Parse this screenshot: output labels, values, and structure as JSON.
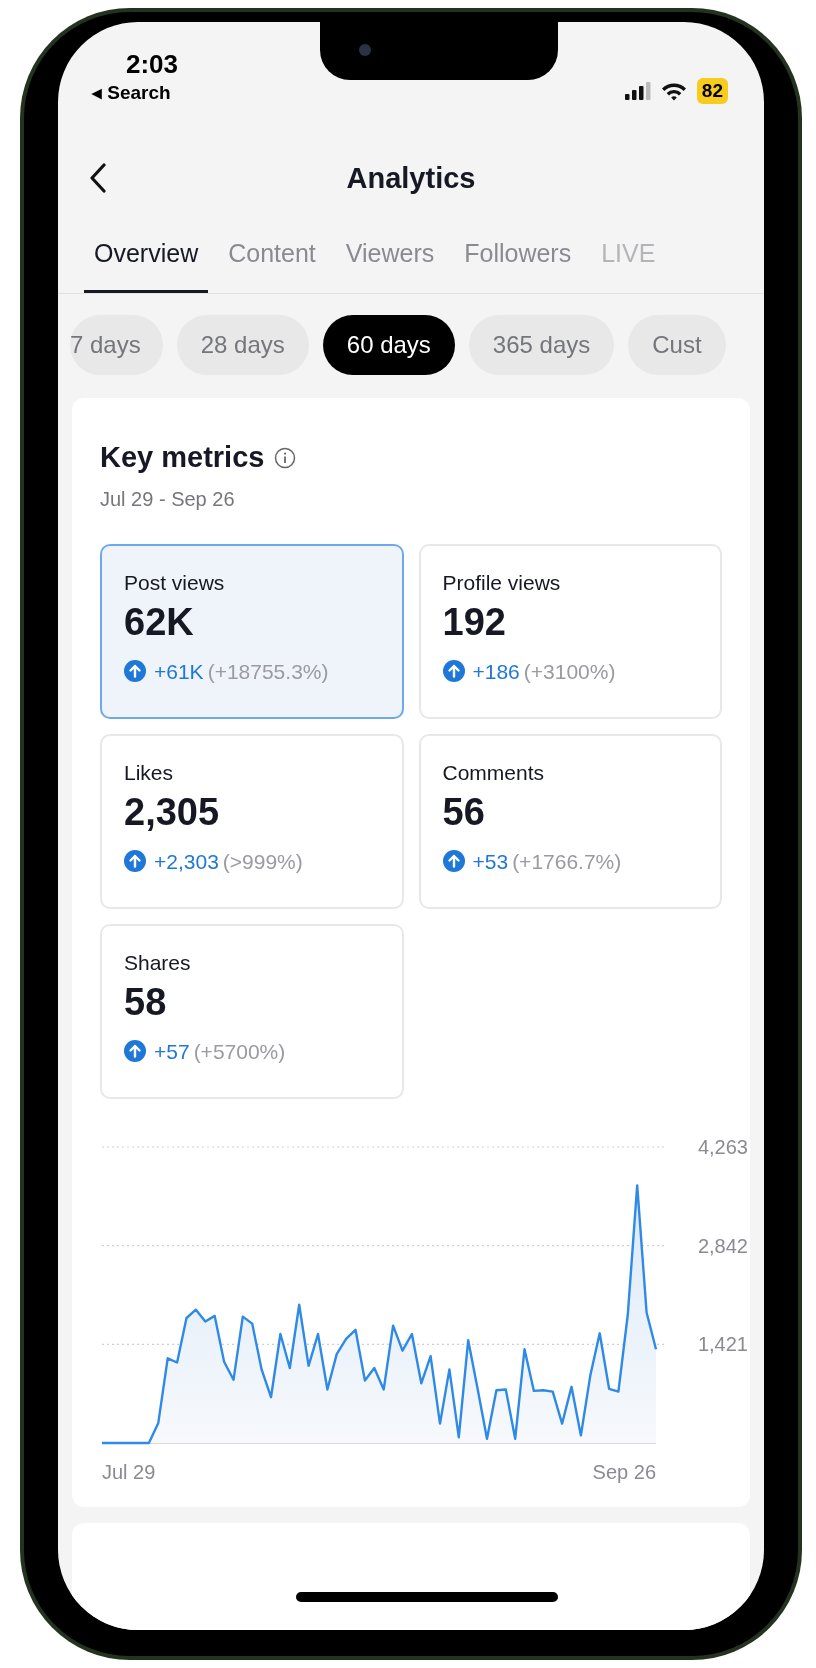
{
  "status_bar": {
    "time": "2:03",
    "back_link": "◂ Search",
    "battery": "82"
  },
  "header": {
    "title": "Analytics"
  },
  "tabs": [
    {
      "label": "Overview",
      "selected": true
    },
    {
      "label": "Content",
      "selected": false
    },
    {
      "label": "Viewers",
      "selected": false
    },
    {
      "label": "Followers",
      "selected": false
    },
    {
      "label": "LIVE",
      "selected": false
    }
  ],
  "ranges": [
    {
      "label": "7 days",
      "selected": false
    },
    {
      "label": "28 days",
      "selected": false
    },
    {
      "label": "60 days",
      "selected": true
    },
    {
      "label": "365 days",
      "selected": false
    },
    {
      "label": "Cust",
      "selected": false
    }
  ],
  "key_metrics": {
    "title": "Key metrics",
    "date_range": "Jul 29 - Sep 26",
    "metrics": [
      {
        "label": "Post views",
        "value": "62K",
        "change": "+61K",
        "percent": "(+18755.3%)",
        "selected": true
      },
      {
        "label": "Profile views",
        "value": "192",
        "change": "+186",
        "percent": "(+3100%)",
        "selected": false
      },
      {
        "label": "Likes",
        "value": "2,305",
        "change": "+2,303",
        "percent": "(>999%)",
        "selected": false
      },
      {
        "label": "Comments",
        "value": "56",
        "change": "+53",
        "percent": "(+1766.7%)",
        "selected": false
      },
      {
        "label": "Shares",
        "value": "58",
        "change": "+57",
        "percent": "(+5700%)",
        "selected": false
      }
    ],
    "x_axis_labels": [
      "Jul 29",
      "Sep 26"
    ],
    "chart_data": {
      "type": "area",
      "ylim": [
        0,
        4263
      ],
      "yticks": [
        {
          "value": 1421,
          "label": "1,421"
        },
        {
          "value": 2842,
          "label": "2,842"
        },
        {
          "value": 4263,
          "label": "4,263"
        }
      ],
      "series": [
        {
          "color": "#2f8ae6",
          "values": [
            0,
            0,
            0,
            0,
            0,
            0,
            290,
            1220,
            1160,
            1800,
            1920,
            1750,
            1830,
            1170,
            910,
            1820,
            1720,
            1060,
            660,
            1570,
            1080,
            1990,
            1110,
            1570,
            770,
            1280,
            1500,
            1630,
            900,
            1080,
            770,
            1690,
            1330,
            1570,
            860,
            1250,
            280,
            1060,
            80,
            1480,
            780,
            60,
            760,
            770,
            60,
            1350,
            750,
            760,
            740,
            280,
            810,
            110,
            970,
            1580,
            780,
            740,
            1850,
            3710,
            1880,
            1350
          ]
        }
      ]
    }
  }
}
